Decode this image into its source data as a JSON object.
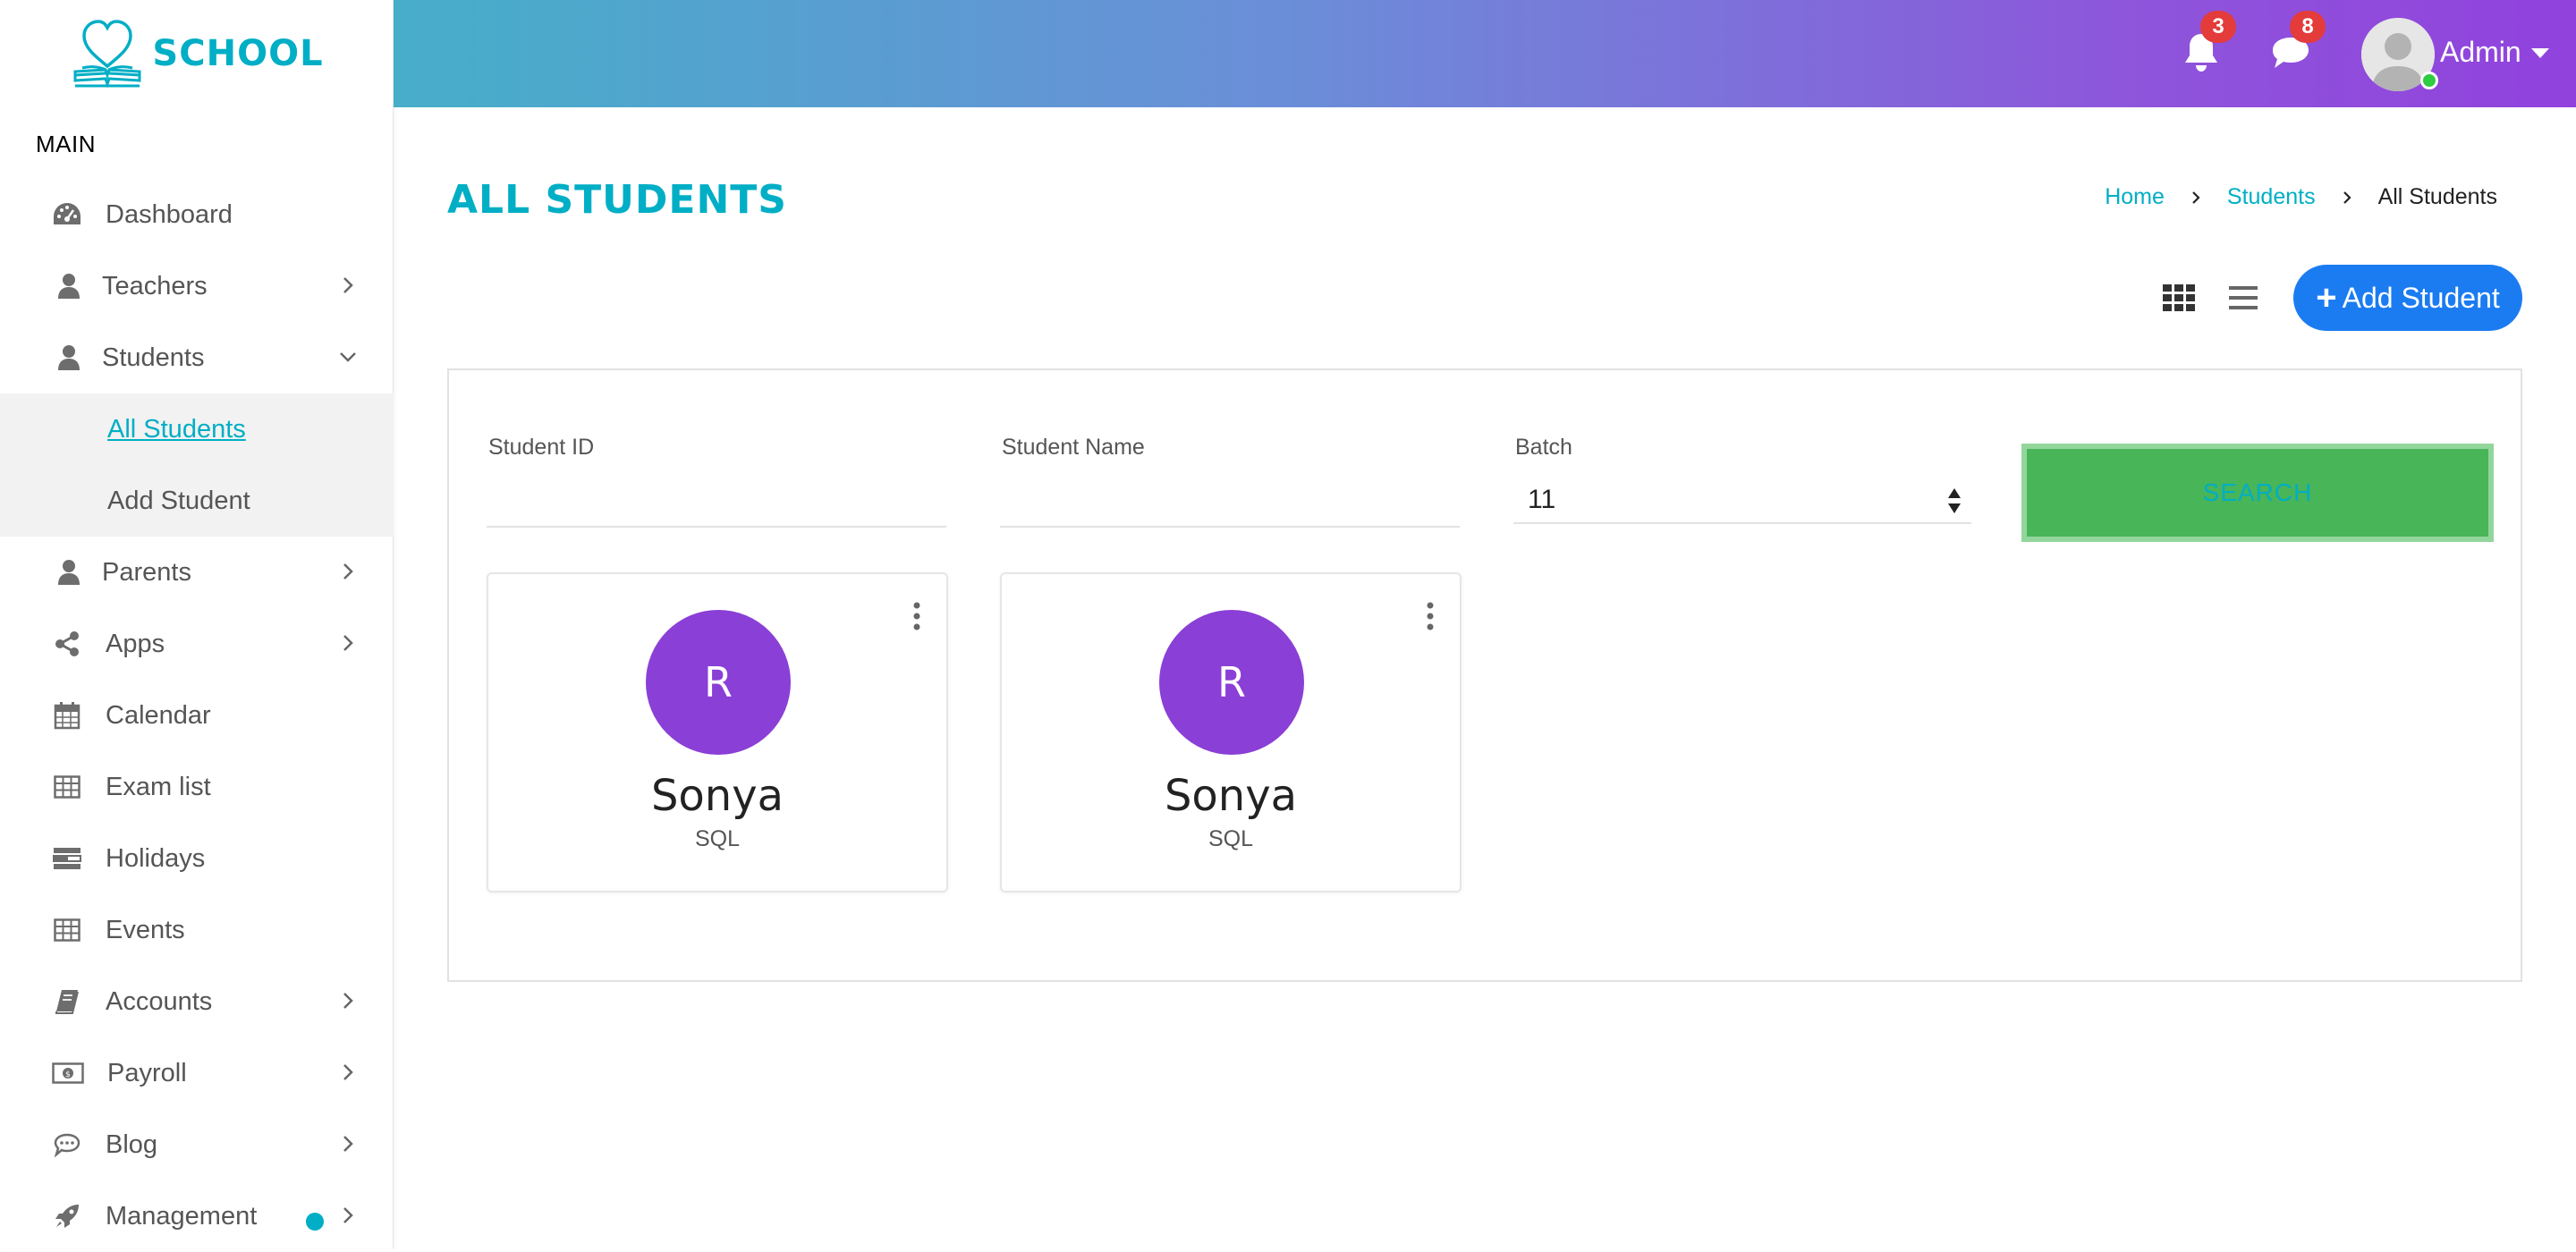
{
  "brand": {
    "name": "SCHOOL"
  },
  "sidebar": {
    "section_label": "MAIN",
    "items": [
      {
        "label": "Dashboard",
        "icon": "dashboard-icon"
      },
      {
        "label": "Teachers",
        "icon": "user-icon"
      },
      {
        "label": "Students",
        "icon": "user-icon"
      },
      {
        "label": "Parents",
        "icon": "user-icon"
      },
      {
        "label": "Apps",
        "icon": "share-icon"
      },
      {
        "label": "Calendar",
        "icon": "calendar-icon"
      },
      {
        "label": "Exam list",
        "icon": "table-icon"
      },
      {
        "label": "Holidays",
        "icon": "holidays-icon"
      },
      {
        "label": "Events",
        "icon": "table-icon"
      },
      {
        "label": "Accounts",
        "icon": "book-icon"
      },
      {
        "label": "Payroll",
        "icon": "money-icon"
      },
      {
        "label": "Blog",
        "icon": "chat-icon"
      },
      {
        "label": "Management",
        "icon": "rocket-icon"
      }
    ],
    "students_submenu": [
      {
        "label": "All Students",
        "active": true
      },
      {
        "label": "Add Student",
        "active": false
      }
    ]
  },
  "header": {
    "notifications_count": "3",
    "messages_count": "8",
    "user_name": "Admin"
  },
  "page": {
    "title": "ALL STUDENTS",
    "breadcrumb": [
      "Home",
      "Students",
      "All Students"
    ],
    "add_button_label": "Add Student"
  },
  "filters": {
    "student_id_label": "Student ID",
    "student_id_value": "",
    "student_name_label": "Student Name",
    "student_name_value": "",
    "batch_label": "Batch",
    "batch_value": "11",
    "search_label": "SEARCH"
  },
  "students": [
    {
      "initial": "R",
      "name": "Sonya",
      "subject": "SQL"
    },
    {
      "initial": "R",
      "name": "Sonya",
      "subject": "SQL"
    }
  ],
  "colors": {
    "accent": "#00aec5",
    "primary_button": "#1b7cf2",
    "search_button": "#48b558",
    "avatar": "#8a3fd6",
    "badge": "#e43b3b"
  }
}
